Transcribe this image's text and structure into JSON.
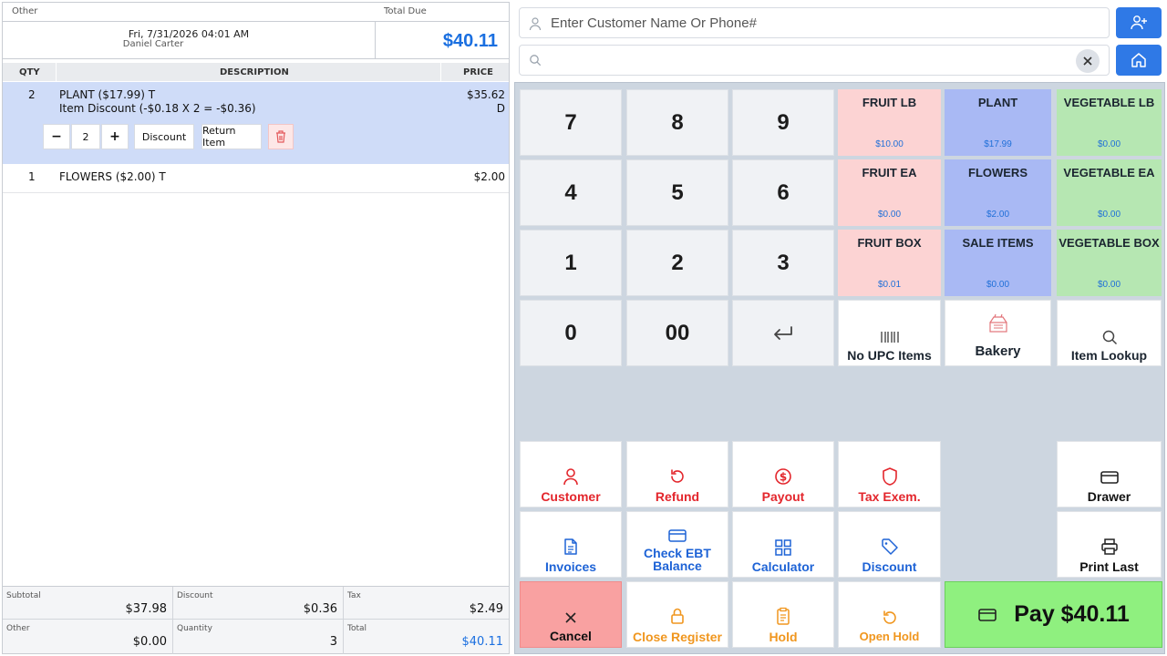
{
  "ticket": {
    "label_other": "Other",
    "label_total_due": "Total Due",
    "datetime": "Fri, 7/31/2026 04:01 AM",
    "cashier": "Daniel Carter",
    "total_due": "$40.11"
  },
  "columns": {
    "qty": "QTY",
    "description": "DESCRIPTION",
    "price": "PRICE"
  },
  "items": [
    {
      "qty": "2",
      "desc_line1": "PLANT ($17.99)  T",
      "desc_line2": "Item Discount (-$0.18 X 2 = -$0.36)",
      "price": "$35.62",
      "price_flag": "D",
      "stepper_value": "2",
      "minus": "−",
      "plus": "+",
      "discount_label": "Discount",
      "return_label": "Return Item"
    },
    {
      "qty": "1",
      "desc_line1": "FLOWERS ($2.00)  T",
      "price": "$2.00"
    }
  ],
  "summary": {
    "subtotal_label": "Subtotal",
    "subtotal": "$37.98",
    "discount_label": "Discount",
    "discount": "$0.36",
    "tax_label": "Tax",
    "tax": "$2.49",
    "other_label": "Other",
    "other": "$0.00",
    "quantity_label": "Quantity",
    "quantity": "3",
    "total_label": "Total",
    "total": "$40.11"
  },
  "search": {
    "customer_placeholder": "Enter Customer Name Or Phone#",
    "clear_symbol": "✕"
  },
  "keypad": [
    "7",
    "8",
    "9",
    "4",
    "5",
    "6",
    "1",
    "2",
    "3",
    "0",
    "00"
  ],
  "products": [
    {
      "name": "FRUIT LB",
      "price": "$10.00"
    },
    {
      "name": "PLANT",
      "price": "$17.99"
    },
    {
      "name": "VEGETABLE LB",
      "price": "$0.00"
    },
    {
      "name": "FRUIT EA",
      "price": "$0.00"
    },
    {
      "name": "FLOWERS",
      "price": "$2.00"
    },
    {
      "name": "VEGETABLE EA",
      "price": "$0.00"
    },
    {
      "name": "FRUIT BOX",
      "price": "$0.01"
    },
    {
      "name": "SALE ITEMS",
      "price": "$0.00"
    },
    {
      "name": "VEGETABLE BOX",
      "price": "$0.00"
    }
  ],
  "tools": {
    "no_upc": "No UPC Items",
    "bakery": "Bakery",
    "item_lookup": "Item Lookup"
  },
  "actions": {
    "customer": "Customer",
    "refund": "Refund",
    "payout": "Payout",
    "tax_exem": "Tax Exem.",
    "drawer": "Drawer",
    "invoices": "Invoices",
    "check_ebt_1": "Check EBT",
    "check_ebt_2": "Balance",
    "calculator": "Calculator",
    "discount": "Discount",
    "print_last": "Print Last",
    "cancel": "Cancel",
    "close_register": "Close Register",
    "hold": "Hold",
    "open_hold": "Open Hold",
    "pay": "Pay $40.11"
  },
  "colors": {
    "fruit": "#fcd3d3",
    "plant": "#a9b9f4",
    "vegetable": "#b6e7b2",
    "red_action": "#e3262c",
    "blue_action": "#1e63d6",
    "orange_action": "#f0961e",
    "pay_green": "#8ff07f",
    "cancel_bg": "#f9a1a1"
  }
}
